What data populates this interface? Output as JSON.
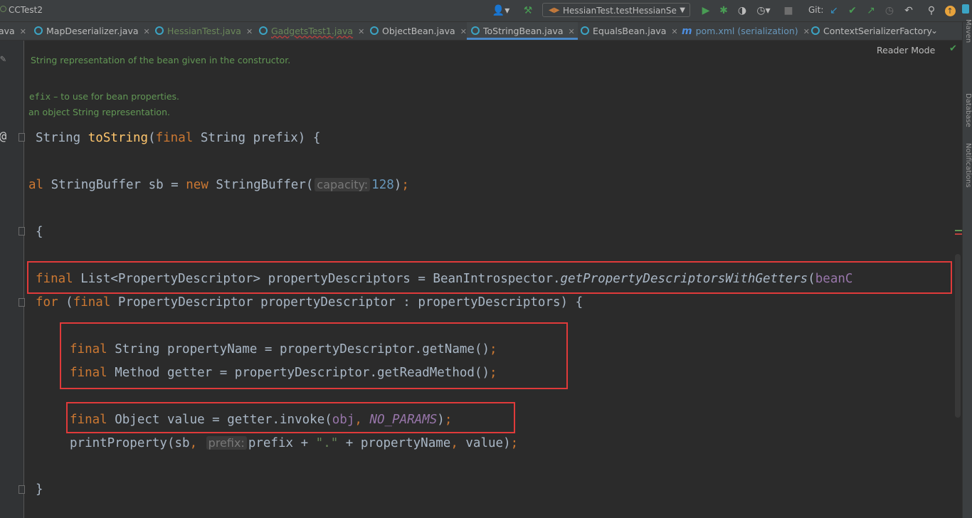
{
  "toolbar": {
    "project_name": "CCTest2",
    "run_config": "HessianTest.testHessianSer",
    "git_label": "Git:"
  },
  "tabs": [
    {
      "label": "ava",
      "style": "plain",
      "closable": true
    },
    {
      "label": "MapDeserializer.java",
      "style": "plain",
      "closable": true
    },
    {
      "label": "HessianTest.java",
      "style": "green",
      "closable": true
    },
    {
      "label": "GadgetsTest1.java",
      "style": "red",
      "closable": true
    },
    {
      "label": "ObjectBean.java",
      "style": "plain",
      "closable": true
    },
    {
      "label": "ToStringBean.java",
      "style": "active",
      "closable": true
    },
    {
      "label": "EqualsBean.java",
      "style": "plain",
      "closable": true
    },
    {
      "label": "pom.xml (serialization)",
      "style": "blue",
      "closable": true
    },
    {
      "label": "ContextSerializerFactory",
      "style": "plain",
      "closable": false
    }
  ],
  "side_tools": [
    "Maven",
    "Database",
    "Notifications"
  ],
  "editor": {
    "reader_mode_label": "Reader Mode",
    "doc_summary": "String representation of the bean given in the constructor.",
    "doc_param_name": "efix",
    "doc_param_desc": " – to use for bean properties.",
    "doc_return": "an object String representation.",
    "gutter_override_mark": "@",
    "hint_capacity": "capacity:",
    "hint_prefix": "prefix:",
    "highlight_color": "#e03a3a"
  }
}
